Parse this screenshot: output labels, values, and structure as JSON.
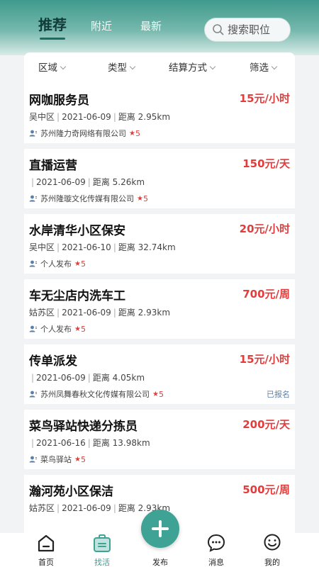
{
  "header": {
    "tabs": [
      {
        "label": "推荐",
        "active": true
      },
      {
        "label": "附近",
        "active": false
      },
      {
        "label": "最新",
        "active": false
      }
    ],
    "search": {
      "placeholder": "搜索职位",
      "icon": "search-icon"
    }
  },
  "filters": [
    {
      "label": "区域"
    },
    {
      "label": "类型"
    },
    {
      "label": "结算方式"
    },
    {
      "label": "筛选"
    }
  ],
  "jobs": [
    {
      "title": "网咖服务员",
      "salary": "15元/小时",
      "district": "吴中区",
      "date": "2021-06-09",
      "distance": "距离 2.95km",
      "poster": "苏州隆力奇网络有限公司",
      "rating": "5",
      "tag": ""
    },
    {
      "title": "直播运营",
      "salary": "150元/天",
      "district": "",
      "date": "2021-06-09",
      "distance": "距离 5.26km",
      "poster": "苏州隆璇文化传媒有限公司",
      "rating": "5",
      "tag": ""
    },
    {
      "title": "水岸清华小区保安",
      "salary": "20元/小时",
      "district": "吴中区",
      "date": "2021-06-10",
      "distance": "距离 32.74km",
      "poster": "个人发布",
      "rating": "5",
      "tag": ""
    },
    {
      "title": "车无尘店内洗车工",
      "salary": "700元/周",
      "district": "姑苏区",
      "date": "2021-06-09",
      "distance": "距离 2.93km",
      "poster": "个人发布",
      "rating": "5",
      "tag": ""
    },
    {
      "title": "传单派发",
      "salary": "15元/小时",
      "district": "",
      "date": "2021-06-09",
      "distance": "距离 4.05km",
      "poster": "苏州凤舞春秋文化传媒有限公司",
      "rating": "5",
      "tag": "已报名"
    },
    {
      "title": "菜鸟驿站快递分拣员",
      "salary": "200元/天",
      "district": "",
      "date": "2021-06-16",
      "distance": "距离 13.98km",
      "poster": "菜鸟驿站",
      "rating": "5",
      "tag": ""
    },
    {
      "title": "瀚河苑小区保洁",
      "salary": "500元/周",
      "district": "姑苏区",
      "date": "2021-06-09",
      "distance": "距离 2.93km",
      "poster": "",
      "rating": "",
      "tag": ""
    }
  ],
  "tabbar": {
    "items": [
      {
        "label": "首页",
        "icon": "home-icon",
        "active": false
      },
      {
        "label": "找活",
        "icon": "briefcase-icon",
        "active": true
      },
      {
        "label": "发布",
        "icon": "plus-icon",
        "active": false
      },
      {
        "label": "消息",
        "icon": "chat-icon",
        "active": false
      },
      {
        "label": "我的",
        "icon": "smile-face-icon",
        "active": false
      }
    ]
  },
  "colors": {
    "accent": "#3ea295",
    "salary": "#e23c3c",
    "tag": "#5b7fa8"
  }
}
